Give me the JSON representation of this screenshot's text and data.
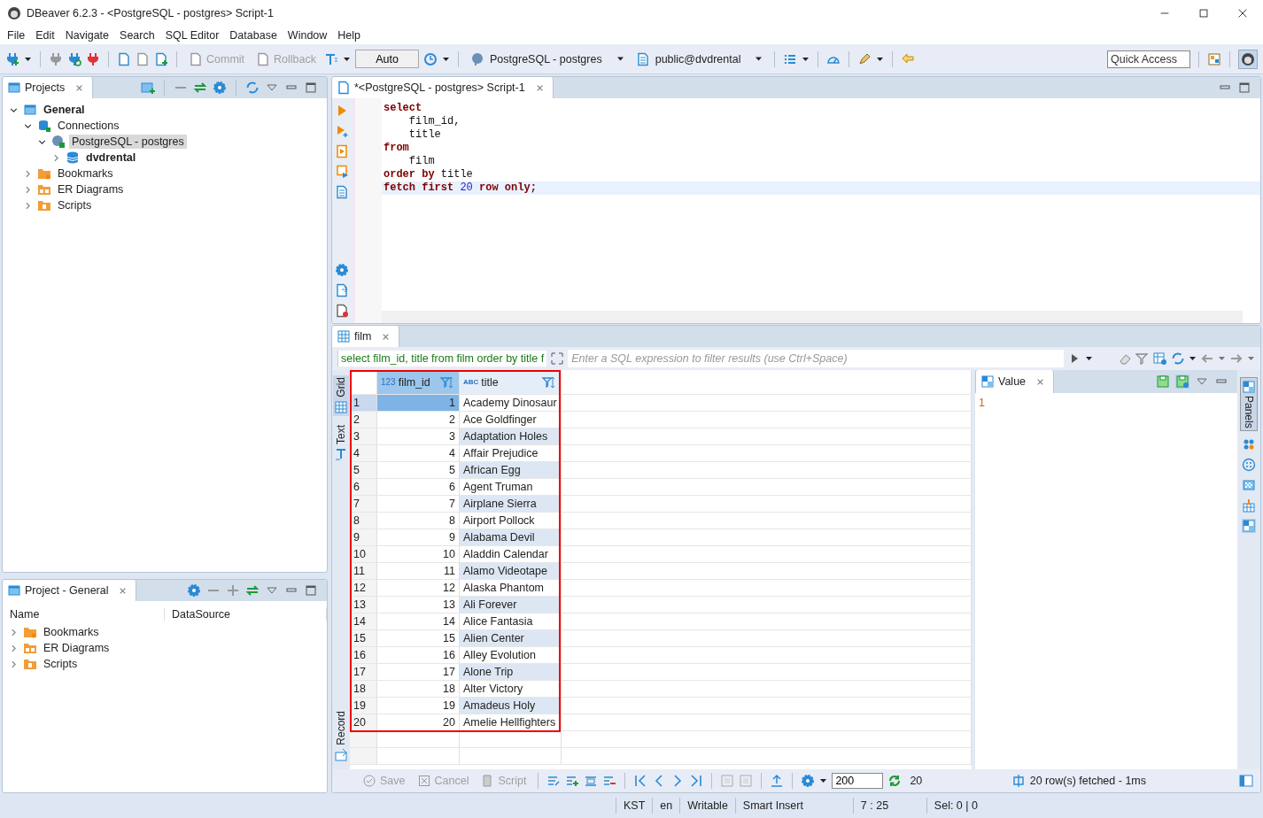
{
  "window": {
    "title": "DBeaver 6.2.3 - <PostgreSQL - postgres> Script-1"
  },
  "menu": [
    "File",
    "Edit",
    "Navigate",
    "Search",
    "SQL Editor",
    "Database",
    "Window",
    "Help"
  ],
  "toolbar": {
    "buttons": [
      {
        "label": "Commit",
        "disabled": true
      },
      {
        "label": "Rollback",
        "disabled": true
      }
    ],
    "transaction_mode": "Auto",
    "connection": "PostgreSQL - postgres",
    "schema": "public@dvdrental",
    "quick_access": {
      "placeholder": "Quick Access"
    }
  },
  "projects_panel": {
    "title": "Projects",
    "tree": [
      {
        "label": "General",
        "kind": "project",
        "active": true,
        "expanded": true,
        "selected": false,
        "children": [
          {
            "label": "Connections",
            "kind": "connections",
            "active": false,
            "expanded": true,
            "selected": false,
            "children": [
              {
                "label": "PostgreSQL - postgres",
                "kind": "connection",
                "active": false,
                "expanded": true,
                "selected": true,
                "children": [
                  {
                    "label": "dvdrental",
                    "kind": "database",
                    "active": true,
                    "expanded": false,
                    "selected": false
                  }
                ]
              }
            ]
          },
          {
            "label": "Bookmarks",
            "kind": "bookmarks",
            "active": false,
            "expanded": false,
            "selected": false
          },
          {
            "label": "ER Diagrams",
            "kind": "diagrams",
            "active": false,
            "expanded": false,
            "selected": false
          },
          {
            "label": "Scripts",
            "kind": "scripts",
            "active": false,
            "expanded": false,
            "selected": false
          }
        ]
      }
    ]
  },
  "project_general_panel": {
    "title": "Project - General",
    "columns": [
      "Name",
      "DataSource"
    ],
    "items": [
      {
        "label": "Bookmarks",
        "kind": "bookmarks",
        "expanded": false
      },
      {
        "label": "ER Diagrams",
        "kind": "diagrams",
        "expanded": false
      },
      {
        "label": "Scripts",
        "kind": "scripts",
        "expanded": false
      }
    ]
  },
  "editor": {
    "tab": "*<PostgreSQL - postgres> Script-1",
    "lines": [
      {
        "current": false,
        "tokens": [
          {
            "kind": "keyword",
            "text": "select"
          }
        ]
      },
      {
        "current": false,
        "tokens": [
          {
            "kind": "ident",
            "text": "    film_id,"
          }
        ]
      },
      {
        "current": false,
        "tokens": [
          {
            "kind": "ident",
            "text": "    title"
          }
        ]
      },
      {
        "current": false,
        "tokens": [
          {
            "kind": "keyword",
            "text": "from"
          }
        ]
      },
      {
        "current": false,
        "tokens": [
          {
            "kind": "ident",
            "text": "    film"
          }
        ]
      },
      {
        "current": false,
        "tokens": [
          {
            "kind": "keyword",
            "text": "order by"
          },
          {
            "kind": "ident",
            "text": " title"
          }
        ]
      },
      {
        "current": true,
        "tokens": [
          {
            "kind": "keyword",
            "text": "fetch first "
          },
          {
            "kind": "number",
            "text": "20"
          },
          {
            "kind": "keyword",
            "text": " row only;"
          }
        ]
      }
    ]
  },
  "results": {
    "tab": "film",
    "query": "select film_id, title from film order by title f",
    "filter": {
      "placeholder": "Enter a SQL expression to filter results (use Ctrl+Space)"
    },
    "side_tabs": [
      {
        "label": "Grid",
        "selected": true
      },
      {
        "label": "Text",
        "selected": false
      },
      {
        "label": "Record",
        "selected": false
      }
    ],
    "columns": [
      {
        "type": "123",
        "name": "film_id"
      },
      {
        "type": "ABC",
        "name": "title"
      }
    ],
    "rows": [
      {
        "num": "1",
        "film_id": "1",
        "title": "Academy Dinosaur",
        "selected": true
      },
      {
        "num": "2",
        "film_id": "2",
        "title": "Ace Goldfinger",
        "selected": false
      },
      {
        "num": "3",
        "film_id": "3",
        "title": "Adaptation Holes",
        "selected": false
      },
      {
        "num": "4",
        "film_id": "4",
        "title": "Affair Prejudice",
        "selected": false
      },
      {
        "num": "5",
        "film_id": "5",
        "title": "African Egg",
        "selected": false
      },
      {
        "num": "6",
        "film_id": "6",
        "title": "Agent Truman",
        "selected": false
      },
      {
        "num": "7",
        "film_id": "7",
        "title": "Airplane Sierra",
        "selected": false
      },
      {
        "num": "8",
        "film_id": "8",
        "title": "Airport Pollock",
        "selected": false
      },
      {
        "num": "9",
        "film_id": "9",
        "title": "Alabama Devil",
        "selected": false
      },
      {
        "num": "10",
        "film_id": "10",
        "title": "Aladdin Calendar",
        "selected": false
      },
      {
        "num": "11",
        "film_id": "11",
        "title": "Alamo Videotape",
        "selected": false
      },
      {
        "num": "12",
        "film_id": "12",
        "title": "Alaska Phantom",
        "selected": false
      },
      {
        "num": "13",
        "film_id": "13",
        "title": "Ali Forever",
        "selected": false
      },
      {
        "num": "14",
        "film_id": "14",
        "title": "Alice Fantasia",
        "selected": false
      },
      {
        "num": "15",
        "film_id": "15",
        "title": "Alien Center",
        "selected": false
      },
      {
        "num": "16",
        "film_id": "16",
        "title": "Alley Evolution",
        "selected": false
      },
      {
        "num": "17",
        "film_id": "17",
        "title": "Alone Trip",
        "selected": false
      },
      {
        "num": "18",
        "film_id": "18",
        "title": "Alter Victory",
        "selected": false
      },
      {
        "num": "19",
        "film_id": "19",
        "title": "Amadeus Holy",
        "selected": false
      },
      {
        "num": "20",
        "film_id": "20",
        "title": "Amelie Hellfighters",
        "selected": false
      }
    ],
    "value_panel": {
      "title": "Value",
      "content": "1"
    },
    "panels_tab": "Panels",
    "bottom": {
      "buttons": [
        {
          "label": "Save",
          "disabled": true
        },
        {
          "label": "Cancel",
          "disabled": true
        },
        {
          "label": "Script",
          "disabled": true
        }
      ],
      "fetch_size": "200",
      "fetch_count": "20",
      "status": "20 row(s) fetched - 1ms"
    }
  },
  "status_bar": [
    "KST",
    "en",
    "Writable",
    "Smart Insert",
    "7 : 25",
    "Sel: 0 | 0"
  ]
}
